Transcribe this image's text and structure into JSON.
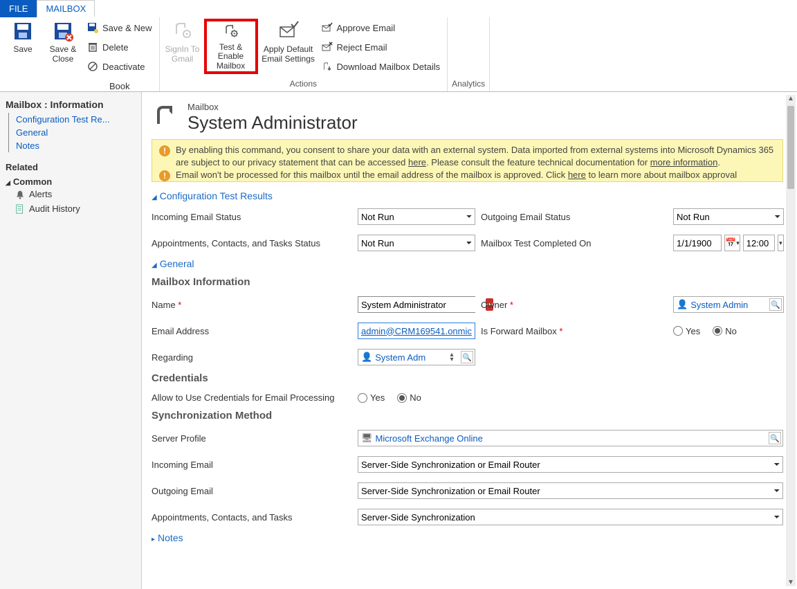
{
  "tabs": {
    "file": "FILE",
    "mailbox": "MAILBOX"
  },
  "ribbon": {
    "save_group": "Save",
    "save": "Save",
    "save_close": "Save & Close",
    "save_new": "Save & New",
    "delete": "Delete",
    "deactivate": "Deactivate",
    "book": "Book",
    "actions_group": "Actions",
    "signin_gmail": "SignIn To Gmail",
    "test_enable": "Test & Enable Mailbox",
    "apply_default": "Apply Default Email Settings",
    "approve_email": "Approve Email",
    "reject_email": "Reject Email",
    "download_details": "Download Mailbox Details",
    "analytics_group": "Analytics"
  },
  "sidebar": {
    "title": "Mailbox : Information",
    "links": [
      "Configuration Test Re...",
      "General",
      "Notes"
    ],
    "related": "Related",
    "common": "Common",
    "alerts": "Alerts",
    "audit": "Audit History"
  },
  "page": {
    "type": "Mailbox",
    "title": "System Administrator",
    "warn1a": "By enabling this command, you consent to share your data with an external system. Data imported from external systems into Microsoft Dynamics 365 are subject to our privacy statement that can be accessed ",
    "warn1_here": "here",
    "warn1b": ". Please consult the feature technical documentation for ",
    "warn1_more": "more information",
    "warn1c": ".",
    "warn2a": "Email won't be processed for this mailbox until the email address of the mailbox is approved. Click ",
    "warn2_here": "here",
    "warn2b": " to learn more about mailbox approval requirements."
  },
  "sections": {
    "cfg": "Configuration Test Results",
    "general": "General",
    "notes": "Notes",
    "mailbox_info": "Mailbox Information",
    "credentials": "Credentials",
    "sync_method": "Synchronization Method"
  },
  "labels": {
    "incoming_status": "Incoming Email Status",
    "outgoing_status": "Outgoing Email Status",
    "appt_status": "Appointments, Contacts, and Tasks Status",
    "test_completed": "Mailbox Test Completed On",
    "name": "Name",
    "owner": "Owner",
    "email": "Email Address",
    "forward": "Is Forward Mailbox",
    "regarding": "Regarding",
    "allow_creds": "Allow to Use Credentials for Email Processing",
    "server_profile": "Server Profile",
    "incoming_email": "Incoming Email",
    "outgoing_email": "Outgoing Email",
    "appt_tasks": "Appointments, Contacts, and Tasks",
    "yes": "Yes",
    "no": "No"
  },
  "values": {
    "not_run": "Not Run",
    "date": "1/1/1900",
    "time": "12:00",
    "name": "System Administrator",
    "owner": "System Admin",
    "email": "admin@CRM169541.onmic",
    "regarding": "System Adm",
    "server_profile": "Microsoft Exchange Online",
    "sync_router": "Server-Side Synchronization or Email Router",
    "sync_only": "Server-Side Synchronization"
  }
}
